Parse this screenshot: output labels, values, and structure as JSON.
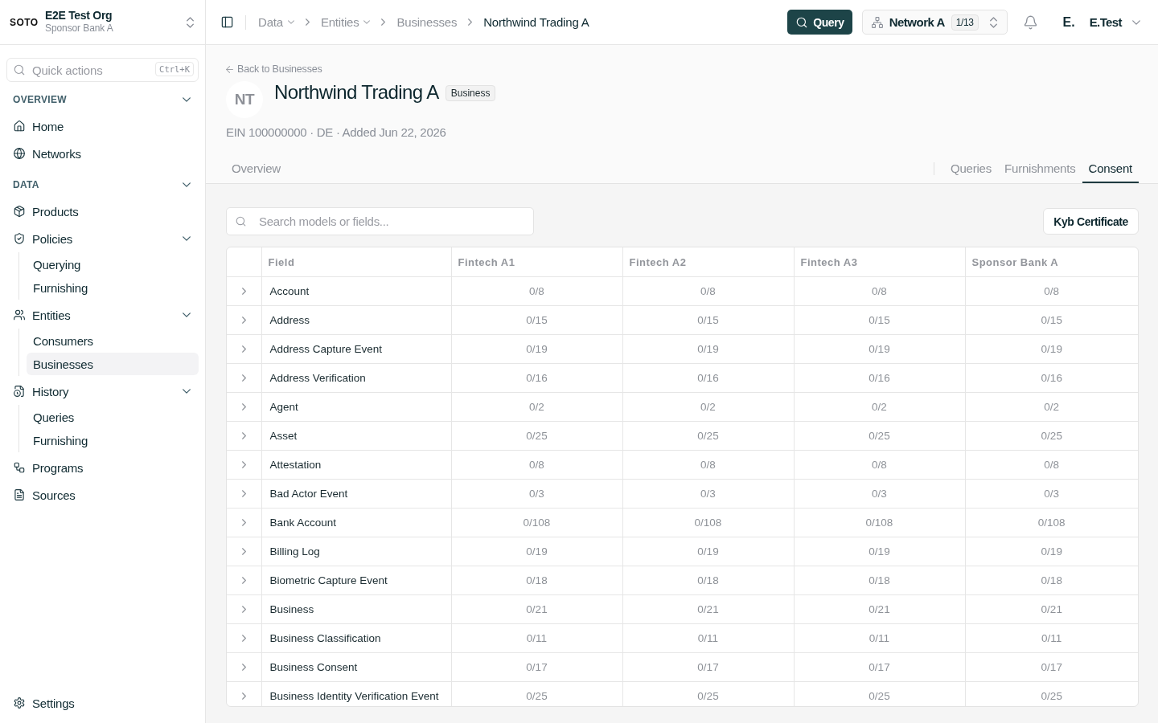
{
  "org": {
    "logo": "SOTO",
    "name": "E2E Test Org",
    "subtitle": "Sponsor Bank A"
  },
  "quick_actions": {
    "placeholder": "Quick actions",
    "shortcut": "Ctrl+K"
  },
  "sidebar": {
    "sections": [
      {
        "title": "OVERVIEW",
        "expanded": true,
        "items": [
          {
            "label": "Home",
            "selected": false
          },
          {
            "label": "Networks",
            "selected": false
          }
        ]
      },
      {
        "title": "DATA",
        "expanded": true,
        "items": [
          {
            "label": "Products",
            "selected": false
          },
          {
            "label": "Policies",
            "selected": false,
            "expanded": true,
            "children": [
              {
                "label": "Querying",
                "selected": false
              },
              {
                "label": "Furnishing",
                "selected": false
              }
            ]
          },
          {
            "label": "Entities",
            "selected": false,
            "expanded": true,
            "children": [
              {
                "label": "Consumers",
                "selected": false
              },
              {
                "label": "Businesses",
                "selected": true
              }
            ]
          },
          {
            "label": "History",
            "selected": false,
            "expanded": true,
            "children": [
              {
                "label": "Queries",
                "selected": false
              },
              {
                "label": "Furnishing",
                "selected": false
              }
            ]
          },
          {
            "label": "Programs",
            "selected": false
          },
          {
            "label": "Sources",
            "selected": false
          }
        ]
      }
    ],
    "footer": {
      "label": "Settings",
      "selected": false
    }
  },
  "header": {
    "breadcrumbs": [
      {
        "label": "Data",
        "has_menu": true,
        "current": false
      },
      {
        "label": "Entities",
        "has_menu": true,
        "current": false
      },
      {
        "label": "Businesses",
        "has_menu": false,
        "current": false
      },
      {
        "label": "Northwind Trading A",
        "has_menu": false,
        "current": true
      }
    ],
    "query_button": "Query",
    "network": {
      "name": "Network A",
      "count": "1/13"
    },
    "user": {
      "initials": "E.",
      "name": "E.Test"
    }
  },
  "entity": {
    "back_link": "Back to Businesses",
    "initials": "NT",
    "name": "Northwind Trading A",
    "badge": "Business",
    "meta": "EIN 100000000 · DE · Added Jun 22, 2026"
  },
  "tabs": {
    "left": [
      {
        "label": "Overview",
        "selected": false
      }
    ],
    "right": [
      {
        "label": "Queries",
        "selected": false
      },
      {
        "label": "Furnishments",
        "selected": false
      },
      {
        "label": "Consent",
        "selected": true
      }
    ]
  },
  "toolbar": {
    "search": {
      "placeholder": "Search models or fields..."
    },
    "button": "Kyb Certificate"
  },
  "table": {
    "columns": [
      "Field",
      "Fintech A1",
      "Fintech A2",
      "Fintech A3",
      "Sponsor Bank A"
    ],
    "rows": [
      {
        "field": "Account",
        "expanded": false,
        "values": [
          "0/8",
          "0/8",
          "0/8",
          "0/8"
        ]
      },
      {
        "field": "Address",
        "expanded": false,
        "values": [
          "0/15",
          "0/15",
          "0/15",
          "0/15"
        ]
      },
      {
        "field": "Address Capture Event",
        "expanded": false,
        "values": [
          "0/19",
          "0/19",
          "0/19",
          "0/19"
        ]
      },
      {
        "field": "Address Verification",
        "expanded": false,
        "values": [
          "0/16",
          "0/16",
          "0/16",
          "0/16"
        ]
      },
      {
        "field": "Agent",
        "expanded": false,
        "values": [
          "0/2",
          "0/2",
          "0/2",
          "0/2"
        ]
      },
      {
        "field": "Asset",
        "expanded": false,
        "values": [
          "0/25",
          "0/25",
          "0/25",
          "0/25"
        ]
      },
      {
        "field": "Attestation",
        "expanded": false,
        "values": [
          "0/8",
          "0/8",
          "0/8",
          "0/8"
        ]
      },
      {
        "field": "Bad Actor Event",
        "expanded": false,
        "values": [
          "0/3",
          "0/3",
          "0/3",
          "0/3"
        ]
      },
      {
        "field": "Bank Account",
        "expanded": false,
        "values": [
          "0/108",
          "0/108",
          "0/108",
          "0/108"
        ]
      },
      {
        "field": "Billing Log",
        "expanded": false,
        "values": [
          "0/19",
          "0/19",
          "0/19",
          "0/19"
        ]
      },
      {
        "field": "Biometric Capture Event",
        "expanded": false,
        "values": [
          "0/18",
          "0/18",
          "0/18",
          "0/18"
        ]
      },
      {
        "field": "Business",
        "expanded": false,
        "values": [
          "0/21",
          "0/21",
          "0/21",
          "0/21"
        ]
      },
      {
        "field": "Business Classification",
        "expanded": false,
        "values": [
          "0/11",
          "0/11",
          "0/11",
          "0/11"
        ]
      },
      {
        "field": "Business Consent",
        "expanded": false,
        "values": [
          "0/17",
          "0/17",
          "0/17",
          "0/17"
        ]
      },
      {
        "field": "Business Identity Verification Event",
        "expanded": false,
        "values": [
          "0/25",
          "0/25",
          "0/25",
          "0/25"
        ]
      }
    ]
  }
}
